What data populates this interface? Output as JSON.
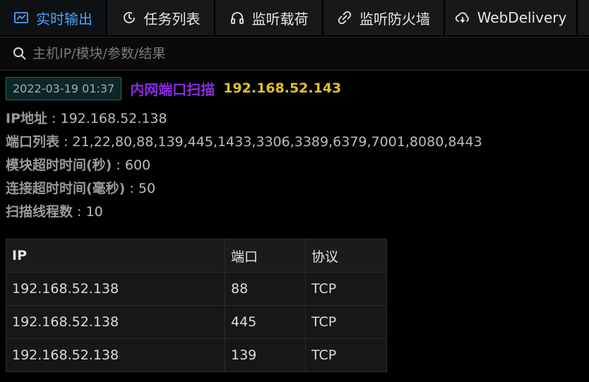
{
  "tabs": [
    {
      "label": "实时输出",
      "icon": "chart-icon",
      "active": true
    },
    {
      "label": "任务列表",
      "icon": "clock-list-icon",
      "active": false
    },
    {
      "label": "监听载荷",
      "icon": "headphones-icon",
      "active": false
    },
    {
      "label": "监听防火墙",
      "icon": "link-broken-icon",
      "active": false
    },
    {
      "label": "WebDelivery",
      "icon": "cloud-download-icon",
      "active": false
    }
  ],
  "search": {
    "placeholder": "主机IP/模块/参数/结果",
    "value": ""
  },
  "task": {
    "time": "2022-03-19 01:37",
    "name": "内网端口扫描",
    "target": "192.168.52.143"
  },
  "params": [
    {
      "key": "IP地址",
      "value": " : 192.168.52.138"
    },
    {
      "key": "端口列表",
      "value": " : 21,22,80,88,139,445,1433,3306,3389,6379,7001,8080,8443"
    },
    {
      "key": "模块超时时间(秒)",
      "value": " : 600"
    },
    {
      "key": "连接超时时间(毫秒)",
      "value": " : 50"
    },
    {
      "key": "扫描线程数",
      "value": " : 10"
    }
  ],
  "table": {
    "headers": [
      "IP",
      "端口",
      "协议"
    ],
    "rows": [
      [
        "192.168.52.138",
        "88",
        "TCP"
      ],
      [
        "192.168.52.138",
        "445",
        "TCP"
      ],
      [
        "192.168.52.138",
        "139",
        "TCP"
      ]
    ]
  },
  "colors": {
    "accent": "#4ea1ff",
    "task_name": "#8a2be2",
    "task_ip": "#e0c02a"
  }
}
